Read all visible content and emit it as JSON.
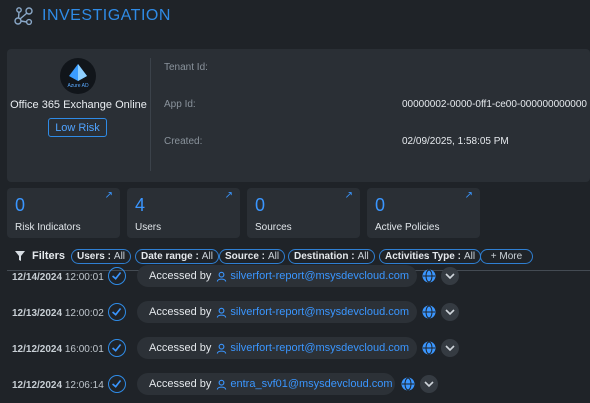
{
  "header": {
    "title": "INVESTIGATION",
    "icon": "investigation-graph-icon"
  },
  "app": {
    "logo_label": "Azure AD",
    "name": "Office 365 Exchange Online",
    "risk_label": "Low Risk",
    "details": [
      {
        "label": "Tenant Id:",
        "value": ""
      },
      {
        "label": "App Id:",
        "value": "00000002-0000-0ff1-ce00-000000000000"
      },
      {
        "label": "Created:",
        "value": "02/09/2025, 1:58:05 PM"
      }
    ]
  },
  "stats": [
    {
      "count": "0",
      "label": "Risk Indicators"
    },
    {
      "count": "4",
      "label": "Users"
    },
    {
      "count": "0",
      "label": "Sources"
    },
    {
      "count": "0",
      "label": "Active Policies"
    }
  ],
  "filters": {
    "title": "Filters",
    "chips": [
      {
        "name": "Users :",
        "value": "All"
      },
      {
        "name": "Date range :",
        "value": "All"
      },
      {
        "name": "Source :",
        "value": "All"
      },
      {
        "name": "Destination :",
        "value": "All"
      },
      {
        "name": "Activities Type :",
        "value": "All"
      }
    ],
    "more_label": "+ More"
  },
  "events": [
    {
      "date": "12/14/2024",
      "time": "12:00:01",
      "action": "Accessed by",
      "user": "silverfort-report@msysdevcloud.com"
    },
    {
      "date": "12/13/2024",
      "time": "12:00:02",
      "action": "Accessed by",
      "user": "silverfort-report@msysdevcloud.com"
    },
    {
      "date": "12/12/2024",
      "time": "16:00:01",
      "action": "Accessed by",
      "user": "silverfort-report@msysdevcloud.com"
    },
    {
      "date": "12/12/2024",
      "time": "12:06:14",
      "action": "Accessed by",
      "user": "entra_svf01@msysdevcloud.com"
    }
  ],
  "colors": {
    "accent": "#2f8be6",
    "background": "#1f2328",
    "card": "#2a2f35"
  }
}
